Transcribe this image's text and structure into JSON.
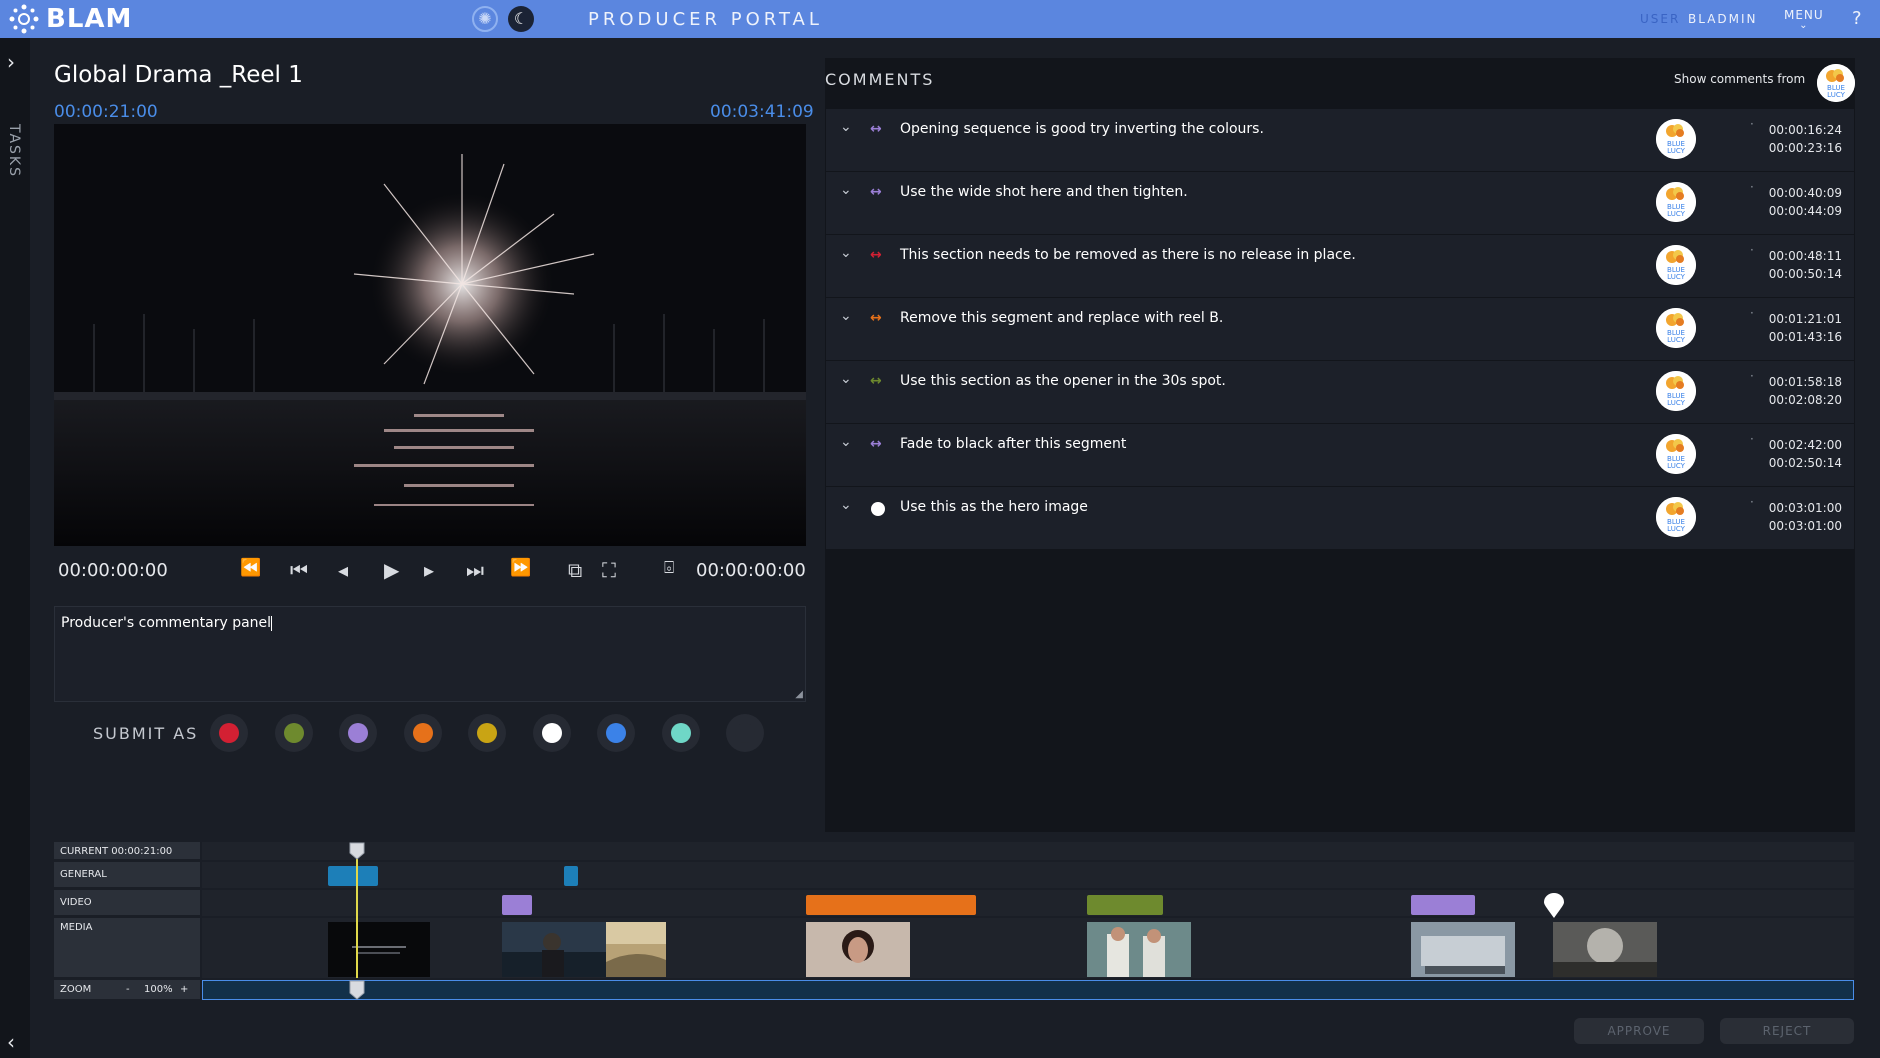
{
  "app": {
    "logo": "BLAM",
    "portal_title": "PRODUCER PORTAL"
  },
  "header": {
    "user_label": "USER",
    "user_name": "BLADMIN",
    "menu_label": "MENU",
    "help_icon": "?"
  },
  "rail": {
    "label": "TASKS"
  },
  "player": {
    "title": "Global Drama _Reel 1",
    "current_tc": "00:00:21:00",
    "duration_tc": "00:03:41:09",
    "in_tc": "00:00:00:00",
    "out_tc": "00:00:00:00"
  },
  "commentary": {
    "text": "Producer's commentary panel"
  },
  "submit": {
    "label": "SUBMIT AS",
    "colors": [
      "#d32033",
      "#6e8a2e",
      "#9b7fd6",
      "#e6711a",
      "#c9a414",
      "#ffffff",
      "#3b82e8",
      "#6fd7c7",
      "#262a33"
    ]
  },
  "comments": {
    "title": "COMMENTS",
    "show_from": "Show comments from",
    "avatar_text": "BLUE LUCY",
    "items": [
      {
        "text": "Opening sequence is good try inverting the colours.",
        "start": "00:00:16:24",
        "end": "00:00:23:16",
        "color": "#9b7fd6",
        "marker": "range"
      },
      {
        "text": "Use the wide shot here and then tighten.",
        "start": "00:00:40:09",
        "end": "00:00:44:09",
        "color": "#9b7fd6",
        "marker": "range"
      },
      {
        "text": "This section needs to be removed as there is no release in place.",
        "start": "00:00:48:11",
        "end": "00:00:50:14",
        "color": "#d32033",
        "marker": "range"
      },
      {
        "text": "Remove this segment and replace with reel B.",
        "start": "00:01:21:01",
        "end": "00:01:43:16",
        "color": "#e6711a",
        "marker": "range"
      },
      {
        "text": "Use this section as the opener in the 30s spot.",
        "start": "00:01:58:18",
        "end": "00:02:08:20",
        "color": "#6e8a2e",
        "marker": "range"
      },
      {
        "text": "Fade to black after this segment",
        "start": "00:02:42:00",
        "end": "00:02:50:14",
        "color": "#9b7fd6",
        "marker": "range"
      },
      {
        "text": "Use this as the hero image",
        "start": "00:03:01:00",
        "end": "00:03:01:00",
        "color": "#ffffff",
        "marker": "point"
      }
    ]
  },
  "timeline": {
    "current_label": "CURRENT 00:00:21:00",
    "tracks": [
      "GENERAL",
      "VIDEO",
      "MEDIA"
    ],
    "zoom_label": "ZOOM",
    "zoom_minus": "-",
    "zoom_value": "100%",
    "zoom_plus": "+"
  },
  "actions": {
    "approve": "APPROVE",
    "reject": "REJECT"
  }
}
